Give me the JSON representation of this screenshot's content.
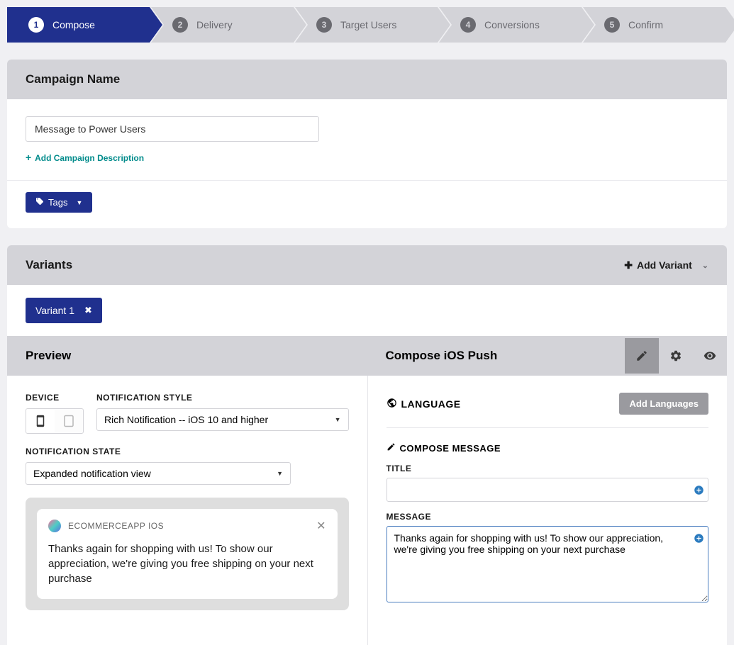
{
  "steps": [
    {
      "num": "1",
      "label": "Compose",
      "active": true
    },
    {
      "num": "2",
      "label": "Delivery",
      "active": false
    },
    {
      "num": "3",
      "label": "Target Users",
      "active": false
    },
    {
      "num": "4",
      "label": "Conversions",
      "active": false
    },
    {
      "num": "5",
      "label": "Confirm",
      "active": false
    }
  ],
  "campaign": {
    "header": "Campaign Name",
    "name": "Message to Power Users",
    "add_desc": "Add Campaign Description",
    "tags_label": "Tags"
  },
  "variants": {
    "header": "Variants",
    "add_label": "Add Variant",
    "chips": [
      "Variant 1"
    ]
  },
  "preview": {
    "header": "Preview",
    "device_label": "DEVICE",
    "style_label": "NOTIFICATION STYLE",
    "style_value": "Rich Notification -- iOS 10 and higher",
    "state_label": "NOTIFICATION STATE",
    "state_value": "Expanded notification view",
    "app_name": "ECOMMERCEAPP IOS",
    "notif_text": "Thanks again for shopping with us! To show our appreciation, we're giving you free shipping on your next purchase"
  },
  "compose": {
    "header": "Compose iOS Push",
    "language_label": "LANGUAGE",
    "add_languages": "Add Languages",
    "compose_msg_label": "COMPOSE MESSAGE",
    "title_label": "TITLE",
    "title_value": "",
    "message_label": "MESSAGE",
    "message_value": "Thanks again for shopping with us! To show our appreciation, we're giving you free shipping on your next purchase"
  }
}
